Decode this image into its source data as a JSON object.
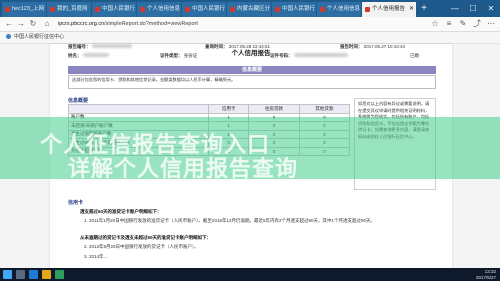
{
  "browser": {
    "tabs": [
      {
        "label": "hec123_上网"
      },
      {
        "label": "我的_百度网"
      },
      {
        "label": "中国人民银行"
      },
      {
        "label": "个人信用信息"
      },
      {
        "label": "中国人民银行"
      },
      {
        "label": "内蒙古藏区分"
      },
      {
        "label": "中国人民银行"
      },
      {
        "label": "个人信用信息"
      },
      {
        "label": "个人信用报告"
      }
    ],
    "active_tab": 8,
    "url_host": "ipcrs.pbccrc.org.cn",
    "url_path": "/simpleReport.do?method=viewReport",
    "bookmark": "中国人民银行征信中心"
  },
  "report": {
    "title": "个人信用报告",
    "report_no_label": "报告编号：",
    "query_time_label": "查询时间：",
    "query_time": "2017.05.28 22:44:51",
    "report_time_label": "报告时间：",
    "report_time": "2017.05.27 10:10:43",
    "name_label": "姓名：",
    "id_type_label": "证件类型：",
    "id_type": "身份证",
    "id_no_label": "证件号码：",
    "married": "已婚",
    "info_band": "信息概要",
    "note": "这部分包含您的信用卡、贷款和其他信贷记录。金额类数据均以人民币计算，精确到元。",
    "summary_heading": "信息概要",
    "table_headers": [
      "",
      "信用卡",
      "住房贷款",
      "其他贷款"
    ],
    "table_rows": [
      [
        "账户数",
        "1",
        "0",
        "0"
      ],
      [
        "未结清/未销户账户数",
        "1",
        "0",
        "0"
      ],
      [
        "发生过逾期的账户数",
        "1",
        "0",
        "0"
      ],
      [
        "发生过90天以上逾期的账户数",
        "0",
        "0",
        "0"
      ],
      [
        "为他人担保笔数",
        "0",
        "0",
        "0"
      ]
    ],
    "side_note": "如您对以上内容有异议或需要说明，请在提交异议申请时提供相关证明材料，系统将为您核实。包括所有账户、包括贷款和信用卡，不包括透支余额为零的贷记卡。如需查询更多内容，请登录本网站或前往人民银行征信中心。",
    "credit_card_heading": "信用卡",
    "para1": "透支超过60天的准贷记卡账户明细如下：",
    "para2": "1. 2011年1月20日中国银行发放的准贷记卡（人民币账户），截至2016年12月仍逾期，最近5年内有2个月透支超过60天，其中1个月透支超过90天。",
    "para3": "从未逾期过的贷记卡及透支未超过60天的准贷记卡账户明细如下：",
    "para4": "2. 2013年9月20日中国银行发放的贷记卡（人民币账户）。",
    "para5": "3. 2014年…"
  },
  "watermark": {
    "line1": "个人征信报告查询入口",
    "line2": "详解个人信用报告查询"
  },
  "taskbar": {
    "time": "13:32",
    "date": "2017/5/27"
  }
}
